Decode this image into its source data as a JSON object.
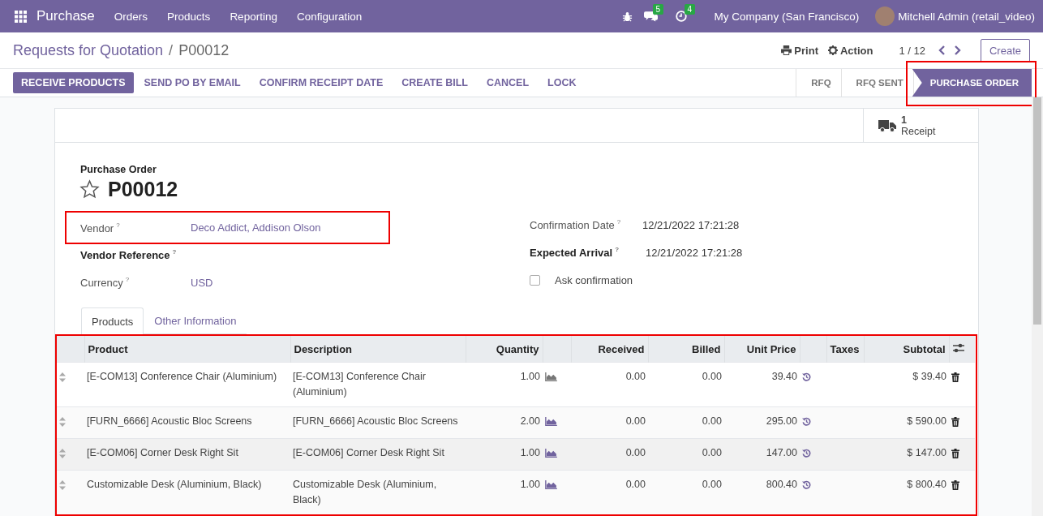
{
  "navbar": {
    "app_name": "Purchase",
    "menu": [
      "Orders",
      "Products",
      "Reporting",
      "Configuration"
    ],
    "messages_count": "5",
    "activities_count": "4",
    "company": "My Company (San Francisco)",
    "user": "Mitchell Admin (retail_video)"
  },
  "breadcrumb": {
    "parent": "Requests for Quotation",
    "separator": "/",
    "current": "P00012"
  },
  "control_panel": {
    "print": "Print",
    "action": "Action",
    "pager": "1 / 12",
    "create": "Create"
  },
  "action_buttons": [
    {
      "label": "RECEIVE PRODUCTS",
      "primary": true
    },
    {
      "label": "SEND PO BY EMAIL",
      "primary": false
    },
    {
      "label": "CONFIRM RECEIPT DATE",
      "primary": false
    },
    {
      "label": "CREATE BILL",
      "primary": false
    },
    {
      "label": "CANCEL",
      "primary": false
    },
    {
      "label": "LOCK",
      "primary": false
    }
  ],
  "status_steps": [
    {
      "label": "RFQ",
      "selected": false
    },
    {
      "label": "RFQ SENT",
      "selected": false
    },
    {
      "label": "PURCHASE ORDER",
      "selected": true
    }
  ],
  "status_highlighted": true,
  "smart_button": {
    "count": "1",
    "label": "Receipt"
  },
  "form": {
    "type_label": "Purchase Order",
    "name": "P00012",
    "starred": false,
    "left_fields": [
      {
        "label": "Vendor",
        "help": "?",
        "value": "Deco Addict, Addison Olson",
        "bold": false,
        "highlighted": true
      },
      {
        "label": "Vendor Reference",
        "help": "?",
        "bold": true,
        "highlighted": false
      },
      {
        "label": "Currency",
        "help": "?",
        "value": "USD",
        "bold": false,
        "highlighted": false
      }
    ],
    "right_fields": [
      {
        "label": "Confirmation Date",
        "help": "?",
        "value": "12/21/2022 17:21:28",
        "bold": false
      },
      {
        "label": "Expected Arrival",
        "help": "?",
        "value": "12/21/2022 17:21:28",
        "bold": true
      }
    ],
    "ask_confirmation": {
      "label": "Ask confirmation",
      "checked": false
    }
  },
  "tabs": [
    {
      "label": "Products",
      "selected": true
    },
    {
      "label": "Other Information",
      "selected": false
    }
  ],
  "table": {
    "highlighted": true,
    "columns": [
      "Product",
      "Description",
      "Quantity",
      "Received",
      "Billed",
      "Unit Price",
      "Taxes",
      "Subtotal"
    ],
    "rows": [
      {
        "product": "[E-COM13] Conference Chair (Aluminium)",
        "description": "[E-COM13] Conference Chair (Aluminium)",
        "quantity": "1.00",
        "received": "0.00",
        "billed": "0.00",
        "unit_price": "39.40",
        "subtotal": "$ 39.40",
        "forecast_ok": false,
        "hovered": false
      },
      {
        "product": "[FURN_6666] Acoustic Bloc Screens",
        "description": "[FURN_6666] Acoustic Bloc Screens",
        "quantity": "2.00",
        "received": "0.00",
        "billed": "0.00",
        "unit_price": "295.00",
        "subtotal": "$ 590.00",
        "forecast_ok": true,
        "hovered": false
      },
      {
        "product": "[E-COM06] Corner Desk Right Sit",
        "description": "[E-COM06] Corner Desk Right Sit",
        "quantity": "1.00",
        "received": "0.00",
        "billed": "0.00",
        "unit_price": "147.00",
        "subtotal": "$ 147.00",
        "forecast_ok": true,
        "hovered": true
      },
      {
        "product": "Customizable Desk (Aluminium, Black)",
        "description": "Customizable Desk (Aluminium, Black)",
        "quantity": "1.00",
        "received": "0.00",
        "billed": "0.00",
        "unit_price": "800.40",
        "subtotal": "$ 800.40",
        "forecast_ok": true,
        "hovered": false
      }
    ]
  }
}
